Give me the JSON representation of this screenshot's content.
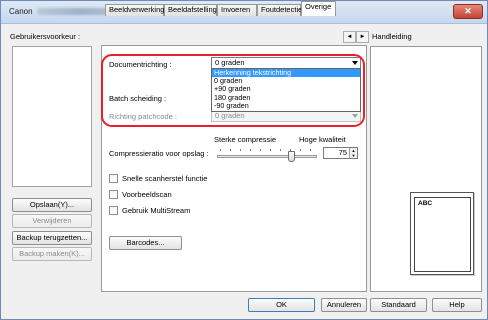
{
  "window": {
    "title": "Canon",
    "close_glyph": "✕"
  },
  "left": {
    "users_label": "Gebruikersvoorkeur :",
    "save_button": "Opslaan(Y)...",
    "delete_button": "Verwijderen",
    "restore_button": "Backup terugzetten...",
    "backup_button": "Backup maken(K)..."
  },
  "tabs": [
    {
      "label": "Beeldverwerking"
    },
    {
      "label": "Beeldafstelling"
    },
    {
      "label": "Invoeren"
    },
    {
      "label": "Foutdetectie"
    },
    {
      "label": "Overige"
    }
  ],
  "tab_nav": {
    "prev": "◄",
    "next": "►"
  },
  "panel": {
    "orientation_label": "Documentrichting :",
    "orientation_value": "0 graden",
    "orientation_options": [
      "Herkenning tekstrichting",
      "0 graden",
      "+90 graden",
      "180 graden",
      "-90 graden"
    ],
    "orientation_selected_index": 0,
    "batch_label": "Batch scheiding :",
    "patchcode_label": "Richting patchcode :",
    "patchcode_value": "0 graden",
    "compression_strong": "Sterke compressie",
    "compression_high": "Hoge kwaliteit",
    "compression_label": "Compressieratio voor opslag :",
    "compression_value": "75",
    "compression_fraction": 0.75,
    "quick_recovery": "Snelle scanherstel functie",
    "prescan": "Voorbeeldscan",
    "multistream": "Gebruik MultiStream",
    "barcodes_button": "Barcodes..."
  },
  "help": {
    "label": "Handleiding",
    "preview_text": "ABC"
  },
  "footer": {
    "ok": "OK",
    "cancel": "Annuleren",
    "default": "Standaard",
    "help": "Help"
  }
}
